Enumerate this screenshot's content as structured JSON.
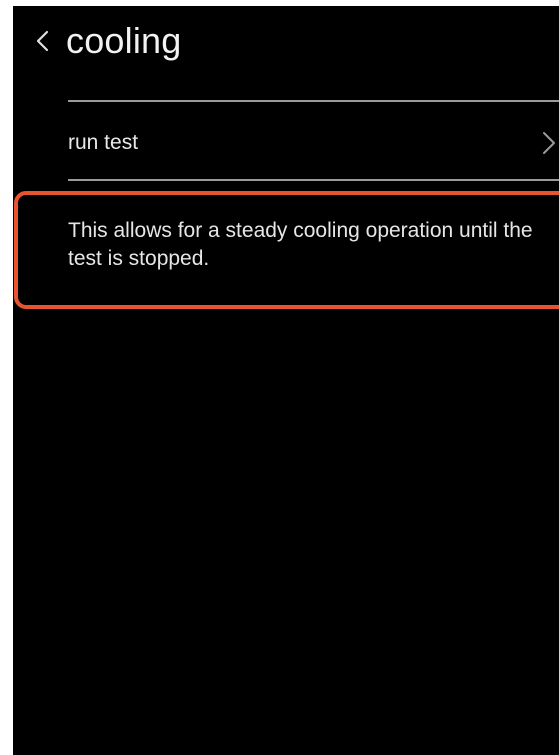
{
  "header": {
    "back_icon": "chevron-left-icon",
    "title": "cooling"
  },
  "menu": {
    "items": [
      {
        "label": "run test",
        "icon": "chevron-right-icon"
      }
    ]
  },
  "description": {
    "text": "This allows for a steady cooling operation until the test is stopped."
  },
  "colors": {
    "background": "#000000",
    "text": "#f2f2f2",
    "divider": "#9a9a9a",
    "highlight": "#e8542f"
  }
}
